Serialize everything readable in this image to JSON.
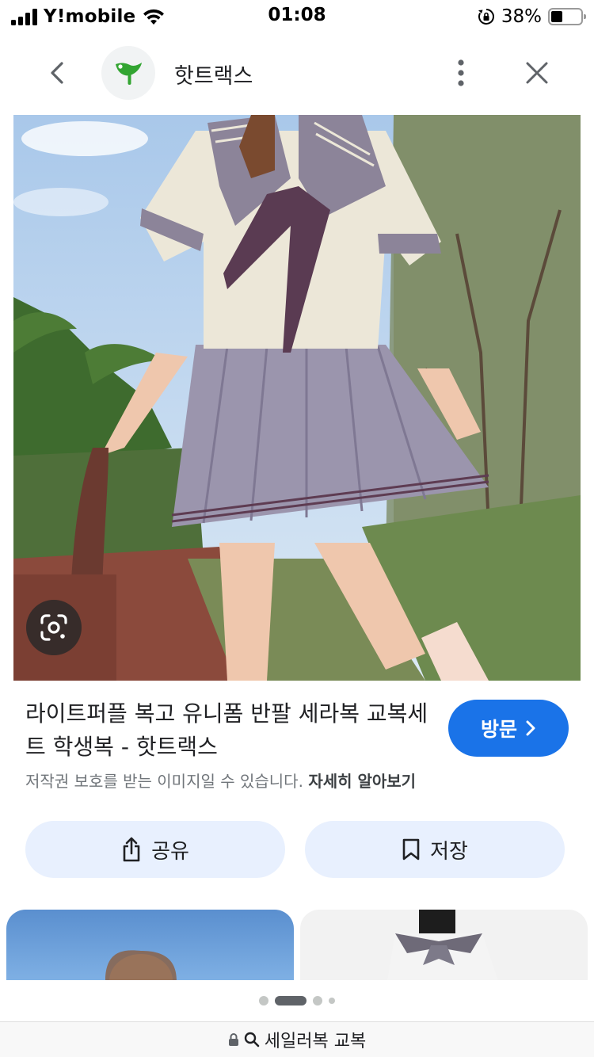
{
  "status_bar": {
    "carrier": "Y!mobile",
    "time": "01:08",
    "battery_percent": "38%",
    "battery_level": 0.38
  },
  "app_bar": {
    "site_name": "핫트랙스",
    "back_icon": "chevron-left-icon",
    "more_icon": "more-vert-icon",
    "close_icon": "close-icon",
    "brand_color": "#33a532"
  },
  "result": {
    "title": "라이트퍼플 복고 유니폼 반팔 세라복 교복세트 학생복 - 핫트랙스",
    "visit_label": "방문",
    "copyright_text": "저작권 보호를 받는 이미지일 수 있습니다.",
    "learn_more": "자세히 알아보기"
  },
  "actions": {
    "share_label": "공유",
    "save_label": "저장"
  },
  "pagination": {
    "count": 4,
    "active_index": 1
  },
  "url_bar": {
    "text": "세일러복 교복"
  },
  "colors": {
    "accent": "#1a73e8",
    "action_bg": "#e8f0fe"
  }
}
